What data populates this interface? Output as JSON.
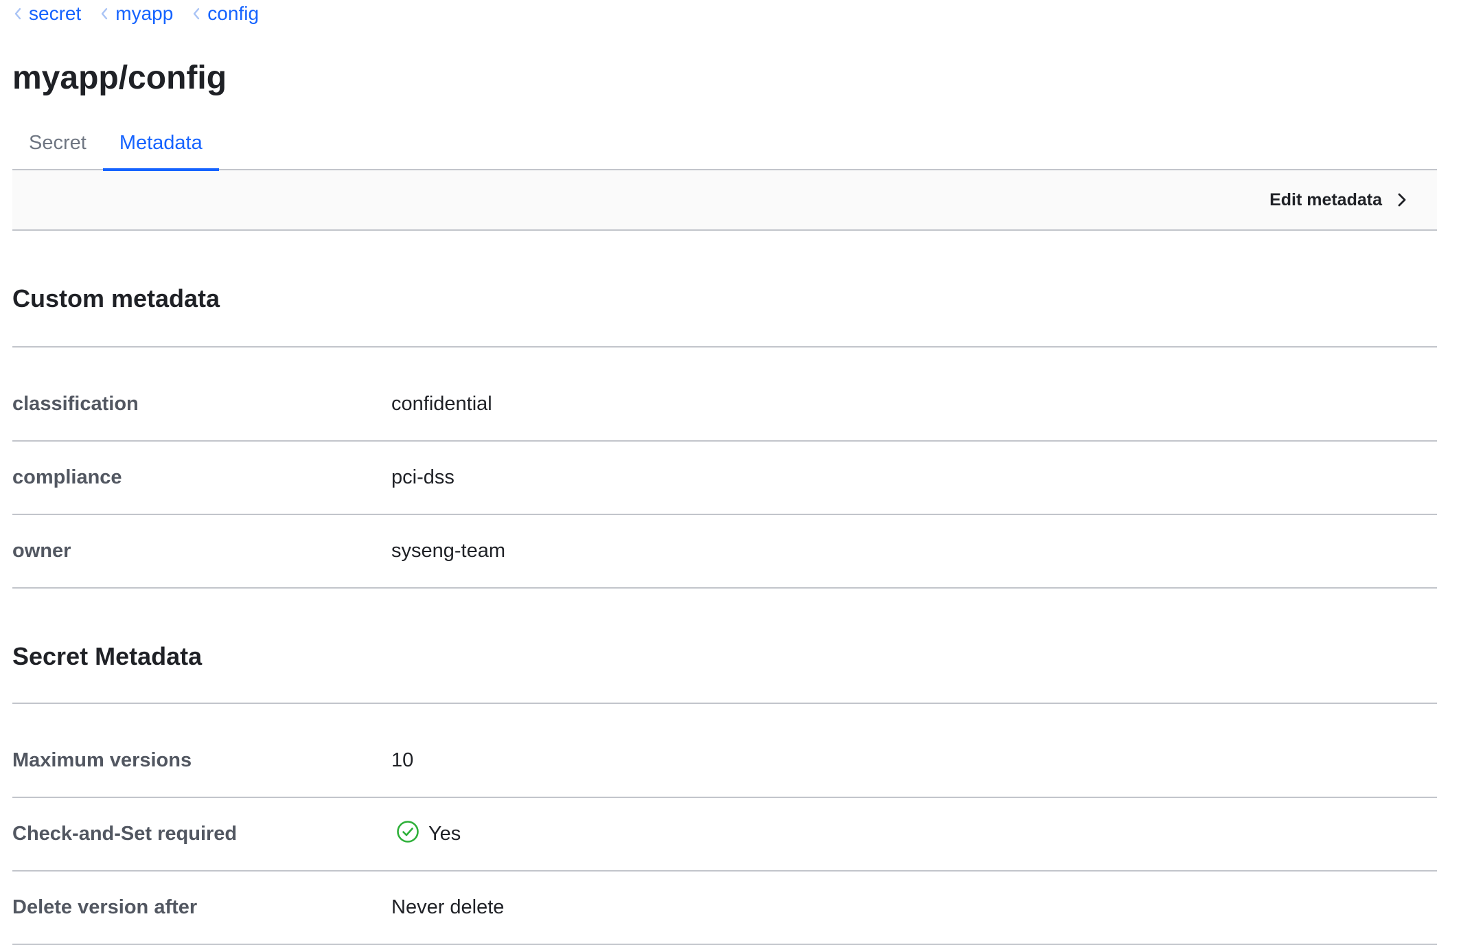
{
  "breadcrumb": {
    "items": [
      {
        "label": "secret"
      },
      {
        "label": "myapp"
      },
      {
        "label": "config"
      }
    ]
  },
  "page": {
    "title": "myapp/config"
  },
  "tabs": [
    {
      "label": "Secret",
      "active": false
    },
    {
      "label": "Metadata",
      "active": true
    }
  ],
  "toolbar": {
    "edit_label": "Edit metadata"
  },
  "custom_metadata": {
    "title": "Custom metadata",
    "rows": [
      {
        "key": "classification",
        "value": "confidential"
      },
      {
        "key": "compliance",
        "value": "pci-dss"
      },
      {
        "key": "owner",
        "value": "syseng-team"
      }
    ]
  },
  "secret_metadata": {
    "title": "Secret Metadata",
    "rows": [
      {
        "key": "Maximum versions",
        "value": "10"
      },
      {
        "key": "Check-and-Set required",
        "value": "Yes",
        "icon": "check-circle-icon"
      },
      {
        "key": "Delete version after",
        "value": "Never delete"
      }
    ]
  },
  "colors": {
    "link": "#1563ff",
    "success": "#2eb039",
    "border": "#c2c5cb",
    "toolbar_bg": "#fafafa"
  }
}
